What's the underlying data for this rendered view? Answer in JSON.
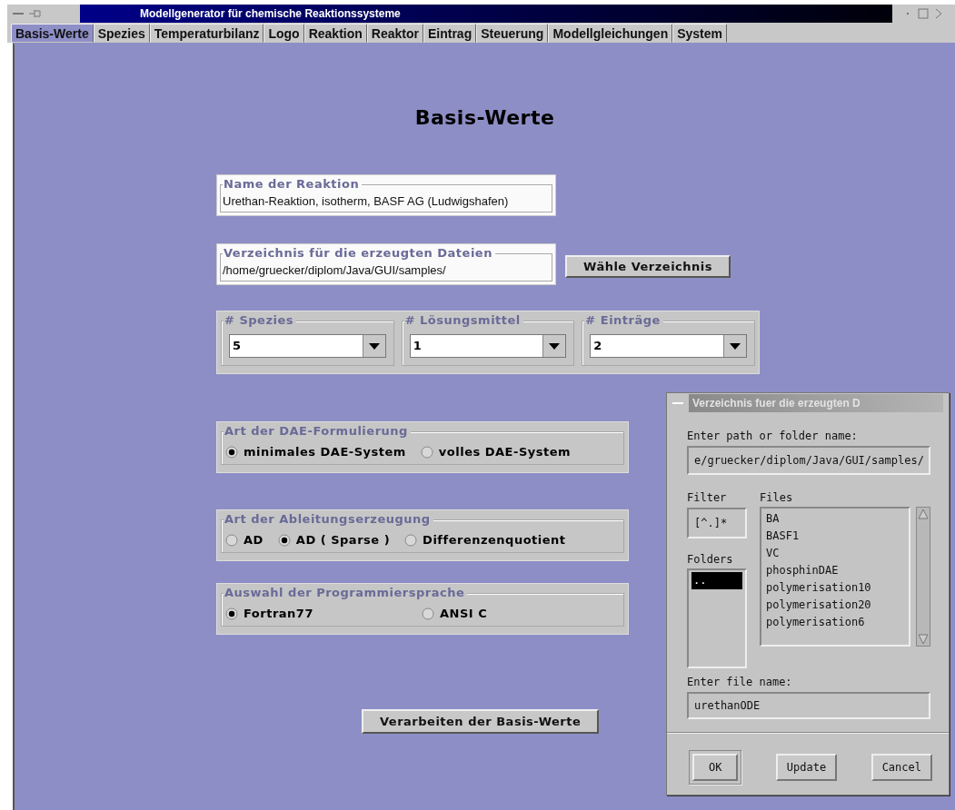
{
  "window": {
    "title": "Modellgenerator für chemische Reaktionssysteme"
  },
  "tabs": [
    {
      "label": "Basis-Werte",
      "selected": true
    },
    {
      "label": "Spezies",
      "selected": false
    },
    {
      "label": "Temperaturbilanz",
      "selected": false
    },
    {
      "label": "Logo",
      "selected": false
    },
    {
      "label": "Reaktion",
      "selected": false
    },
    {
      "label": "Reaktor",
      "selected": false
    },
    {
      "label": "Eintrag",
      "selected": false
    },
    {
      "label": "Steuerung",
      "selected": false
    },
    {
      "label": "Modellgleichungen",
      "selected": false
    },
    {
      "label": "System",
      "selected": false
    }
  ],
  "heading": "Basis-Werte",
  "reaction_name": {
    "label": "Name der Reaktion",
    "value": "Urethan-Reaktion, isotherm, BASF AG (Ludwigshafen)"
  },
  "output_directory": {
    "label": "Verzeichnis für die erzeugten Dateien",
    "value": "/home/gruecker/diplom/Java/GUI/samples/",
    "button": "Wähle Verzeichnis"
  },
  "counts": [
    {
      "label": "# Spezies",
      "value": "5"
    },
    {
      "label": "# Lösungsmittel",
      "value": "1"
    },
    {
      "label": "# Einträge",
      "value": "2"
    }
  ],
  "option_groups": [
    {
      "label": "Art der DAE-Formulierung",
      "options": [
        {
          "label": "minimales DAE-System",
          "selected": true
        },
        {
          "label": "volles DAE-System",
          "selected": false
        }
      ]
    },
    {
      "label": "Art der Ableitungserzeugung",
      "options": [
        {
          "label": "AD",
          "selected": false
        },
        {
          "label": "AD ( Sparse )",
          "selected": true
        },
        {
          "label": "Differenzenquotient",
          "selected": false
        }
      ]
    },
    {
      "label": "Auswahl der Programmiersprache",
      "options": [
        {
          "label": "Fortran77",
          "selected": true
        },
        {
          "label": "ANSI C",
          "selected": false
        }
      ]
    }
  ],
  "process_button": "Verarbeiten der Basis-Werte",
  "dialog": {
    "title": "Verzeichnis fuer die erzeugten D",
    "path_label": "Enter path or folder name:",
    "path_value": "e/gruecker/diplom/Java/GUI/samples/",
    "filter_label": "Filter",
    "filter_value": "[^.]*",
    "folders_label": "Folders",
    "folders": [
      {
        "name": "..",
        "selected": true
      }
    ],
    "files_label": "Files",
    "files": [
      {
        "name": "BA",
        "selected": false
      },
      {
        "name": "BASF1",
        "selected": false
      },
      {
        "name": "VC",
        "selected": false
      },
      {
        "name": "phosphinDAE",
        "selected": false
      },
      {
        "name": "polymerisation10",
        "selected": false
      },
      {
        "name": "polymerisation20",
        "selected": false
      },
      {
        "name": "polymerisation6",
        "selected": false
      }
    ],
    "file_name_label": "Enter file name:",
    "file_name_value": "urethanODE",
    "buttons": [
      {
        "label": "OK",
        "default": true
      },
      {
        "label": "Update",
        "default": false
      },
      {
        "label": "Cancel",
        "default": false
      }
    ]
  }
}
